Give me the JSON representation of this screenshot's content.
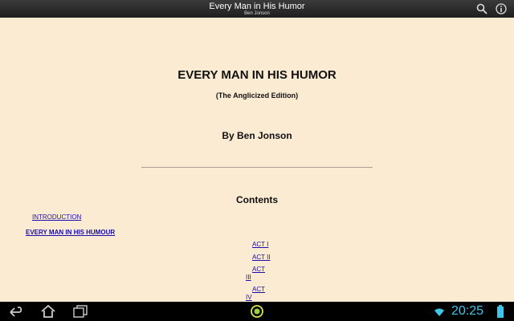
{
  "app_bar": {
    "title": "Every Man in His Humor",
    "subtitle": "Ben Jonson",
    "search_icon": "search-icon",
    "info_icon": "info-icon"
  },
  "book": {
    "title": "EVERY MAN IN HIS HUMOR",
    "edition": "(The Anglicized Edition)",
    "author": "By Ben Jonson",
    "contents_heading": "Contents",
    "toc": {
      "introduction": "INTRODUCTION",
      "every_man": "EVERY MAN IN HIS HUMOUR",
      "act_i": "ACT I",
      "act_ii": "ACT II",
      "act_iii_a": "ACT",
      "act_iii_b": "III",
      "act_iv_a": "ACT",
      "act_iv_b": "IV"
    }
  },
  "system_bar": {
    "time": "20:25",
    "icons": [
      "back-icon",
      "home-icon",
      "recent-apps-icon",
      "app-center-icon",
      "wifi-icon",
      "battery-icon"
    ],
    "accent_color": "#40c4e8"
  },
  "colors": {
    "page_background": "#fcebd3",
    "link": "#1a0dab"
  }
}
